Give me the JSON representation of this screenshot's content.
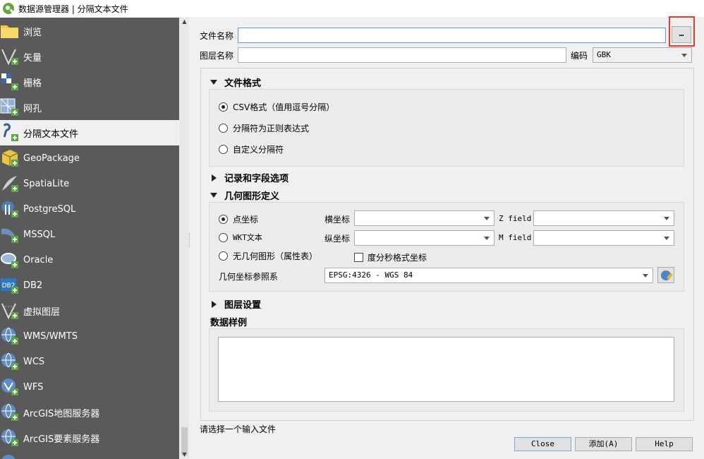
{
  "window": {
    "title": "数据源管理器 | 分隔文本文件"
  },
  "sidebar": {
    "items": [
      {
        "label": "浏览",
        "icon": "folder-icon"
      },
      {
        "label": "矢量",
        "icon": "vector-add-icon"
      },
      {
        "label": "栅格",
        "icon": "raster-add-icon"
      },
      {
        "label": "网孔",
        "icon": "mesh-add-icon"
      },
      {
        "label": "分隔文本文件",
        "icon": "delimited-text-add-icon"
      },
      {
        "label": "GeoPackage",
        "icon": "geopackage-add-icon"
      },
      {
        "label": "SpatiaLite",
        "icon": "spatialite-add-icon"
      },
      {
        "label": "PostgreSQL",
        "icon": "postgresql-add-icon"
      },
      {
        "label": "MSSQL",
        "icon": "mssql-add-icon"
      },
      {
        "label": "Oracle",
        "icon": "oracle-add-icon"
      },
      {
        "label": "DB2",
        "icon": "db2-add-icon"
      },
      {
        "label": "虚拟图层",
        "icon": "virtual-layer-add-icon"
      },
      {
        "label": "WMS/WMTS",
        "icon": "wms-add-icon"
      },
      {
        "label": "WCS",
        "icon": "wcs-add-icon"
      },
      {
        "label": "WFS",
        "icon": "wfs-add-icon"
      },
      {
        "label": "ArcGIS地图服务器",
        "icon": "arcgis-map-add-icon"
      },
      {
        "label": "ArcGIS要素服务器",
        "icon": "arcgis-feature-add-icon"
      }
    ],
    "active_index": 4
  },
  "form": {
    "file_name_label": "文件名称",
    "file_name_value": "",
    "browse_button": "…",
    "layer_name_label": "图层名称",
    "layer_name_value": "",
    "encoding_label": "编码",
    "encoding_value": "GBK"
  },
  "file_format": {
    "title": "文件格式",
    "options": [
      "CSV格式（值用逗号分隔）",
      "分隔符为正则表达式",
      "自定义分隔符"
    ],
    "selected_index": 0
  },
  "record_options": {
    "title": "记录和字段选项"
  },
  "geometry": {
    "title": "几何图形定义",
    "options": [
      "点坐标",
      "WKT文本",
      "无几何图形（属性表）"
    ],
    "selected_index": 0,
    "x_label": "横坐标",
    "y_label": "纵坐标",
    "z_label": "Z field",
    "m_label": "M field",
    "x_value": "",
    "y_value": "",
    "z_value": "",
    "m_value": "",
    "dms_label": "度分秒格式坐标",
    "crs_label": "几何坐标参照系",
    "crs_value": "EPSG:4326 - WGS 84"
  },
  "layer_settings": {
    "title": "图层设置"
  },
  "sample": {
    "title": "数据样例"
  },
  "status": "请选择一个输入文件",
  "buttons": {
    "close": "Close",
    "add": "添加(A)",
    "help": "Help"
  }
}
